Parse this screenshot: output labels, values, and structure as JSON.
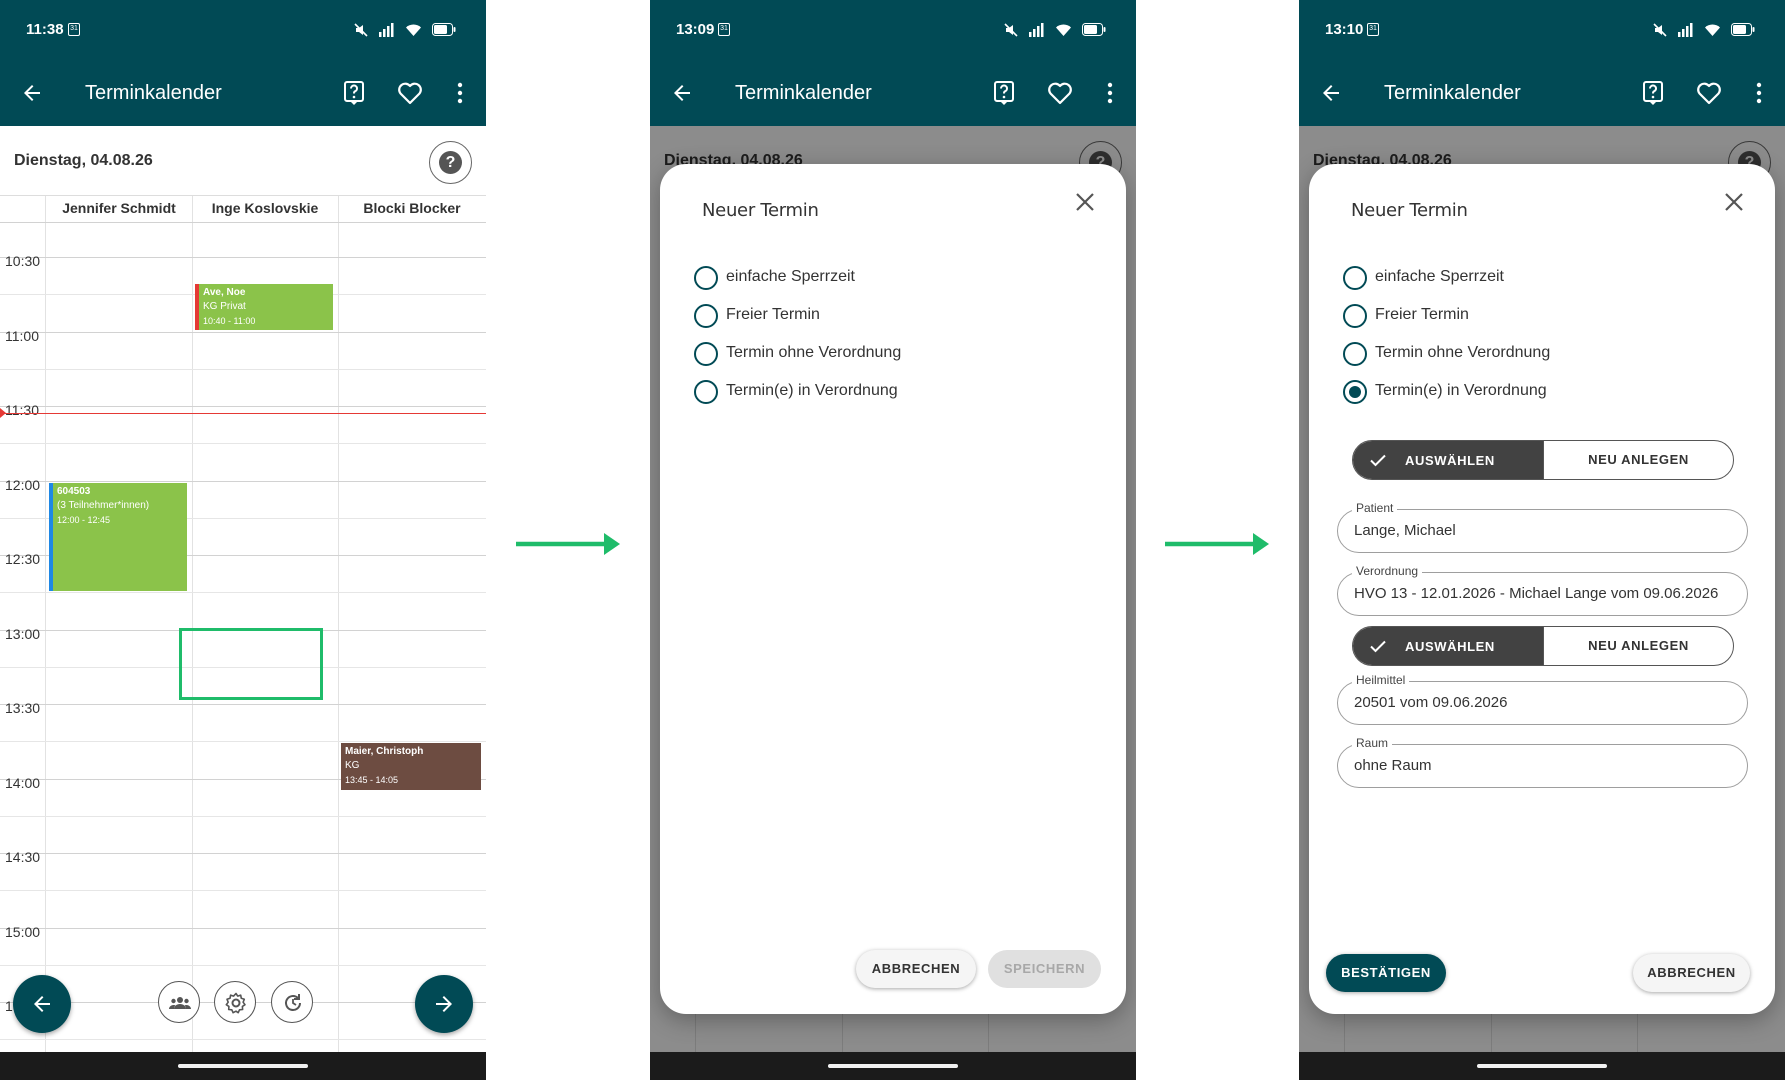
{
  "app": {
    "title": "Terminkalender"
  },
  "colors": {
    "primary": "#014a55",
    "event_green": "#8bc34a",
    "event_brown": "#6d4c41",
    "now_line": "#e53935",
    "selection": "#1fbc6a"
  },
  "screens": [
    {
      "status_time": "11:38",
      "calendar": {
        "date": "Dienstag, 04.08.26",
        "columns": [
          "Jennifer Schmidt",
          "Inge Koslovskie",
          "Blocki Blocker"
        ],
        "time_labels": [
          "10:30",
          "11:00",
          "11:30",
          "12:00",
          "12:30",
          "13:00",
          "13:30",
          "14:00",
          "14:30",
          "15:00",
          "15"
        ],
        "current_time": "11:30",
        "events": [
          {
            "name": "Ave, Noe",
            "detail": "KG Privat",
            "time": "10:40 - 11:00"
          },
          {
            "name": "604503",
            "detail": "(3 Teilnehmer*innen)",
            "time": "12:00 - 12:45"
          },
          {
            "name": "Maier, Christoph",
            "detail": "KG",
            "time": "13:45 - 14:05"
          }
        ],
        "selection": {
          "column": "Inge Koslovskie",
          "start": "13:00",
          "end": "13:30"
        }
      },
      "bottom_tools": [
        "people-icon",
        "gear-icon",
        "refresh-icon"
      ]
    },
    {
      "status_time": "13:09",
      "background": {
        "date": "Dienstag, 04.08.26"
      },
      "dialog": {
        "title": "Neuer Termin",
        "options": [
          "einfache Sperrzeit",
          "Freier Termin",
          "Termin ohne Verordnung",
          "Termin(e) in Verordnung"
        ],
        "selected": -1,
        "cancel": "ABBRECHEN",
        "save": "SPEICHERN"
      }
    },
    {
      "status_time": "13:10",
      "background": {
        "date": "Dienstag, 04.08.26"
      },
      "dialog": {
        "title": "Neuer Termin",
        "options": [
          "einfache Sperrzeit",
          "Freier Termin",
          "Termin ohne Verordnung",
          "Termin(e) in Verordnung"
        ],
        "selected": 3,
        "segment1": {
          "select": "AUSWÄHLEN",
          "create": "NEU ANLEGEN"
        },
        "patient": {
          "label": "Patient",
          "value": "Lange, Michael"
        },
        "verordnung": {
          "label": "Verordnung",
          "value": "HVO 13 - 12.01.2026 - Michael Lange vom 09.06.2026"
        },
        "segment2": {
          "select": "AUSWÄHLEN",
          "create": "NEU ANLEGEN"
        },
        "heilmittel": {
          "label": "Heilmittel",
          "value": "20501 vom 09.06.2026"
        },
        "raum": {
          "label": "Raum",
          "value": "ohne Raum"
        },
        "confirm": "BESTÄTIGEN",
        "cancel": "ABBRECHEN"
      }
    }
  ]
}
